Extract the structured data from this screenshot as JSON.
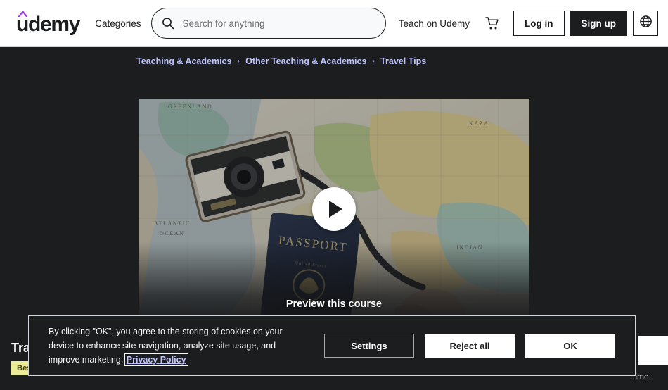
{
  "header": {
    "logo_text": "udemy",
    "categories_label": "Categories",
    "search_placeholder": "Search for anything",
    "search_value": "",
    "teach_label": "Teach on Udemy",
    "cart_icon": "shopping-cart-icon",
    "login_label": "Log in",
    "signup_label": "Sign up",
    "language_icon": "globe-icon",
    "accent_color": "#A435F0",
    "dark_color": "#1C1D1F"
  },
  "breadcrumb": {
    "separator": "›",
    "items": [
      {
        "label": "Teaching & Academics"
      },
      {
        "label": "Other Teaching & Academics"
      },
      {
        "label": "Travel Tips"
      }
    ],
    "color": "#C0C4FC"
  },
  "preview": {
    "play_icon": "play-icon",
    "caption": "Preview this course",
    "image_alt": "vintage camera and US passport on a world map with a hand marking with a pen"
  },
  "course": {
    "title": "Trav",
    "badge": "Best",
    "guarantee_tail": "time."
  },
  "cookie_banner": {
    "text_before_link": "By clicking \"OK\", you agree to the storing of cookies on your device to enhance site navigation, analyze site usage, and improve marketing. ",
    "link_label": "Privacy Policy",
    "settings_label": "Settings",
    "reject_label": "Reject all",
    "ok_label": "OK"
  }
}
